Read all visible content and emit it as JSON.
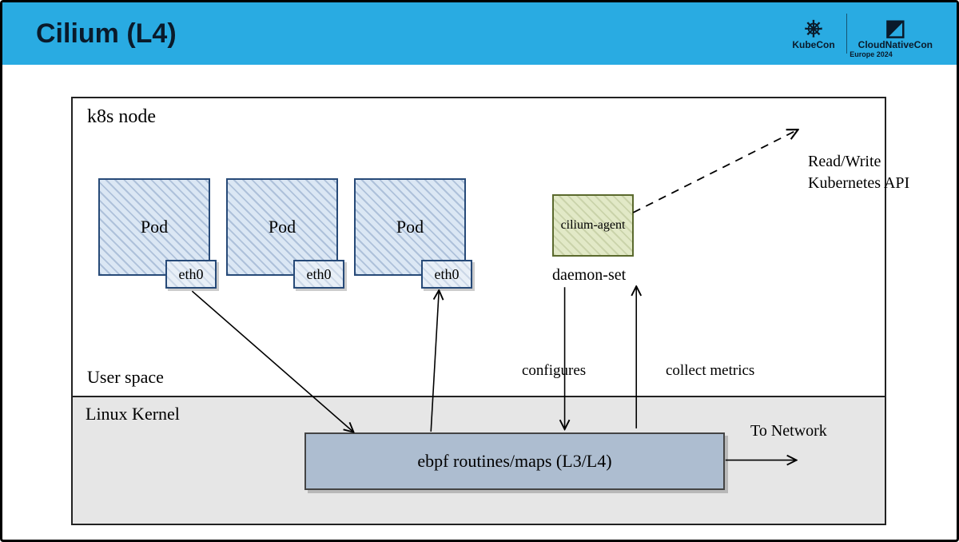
{
  "header": {
    "title": "Cilium (L4)",
    "logos": {
      "left": {
        "icon_label": "KubeCon"
      },
      "right": {
        "icon_label": "CloudNativeCon"
      },
      "subtitle": "Europe 2024"
    }
  },
  "diagram": {
    "node_label": "k8s node",
    "userspace_label": "User space",
    "kernel_label": "Linux Kernel",
    "ebpf_label": "ebpf routines/maps (L3/L4)",
    "pods": [
      {
        "label": "Pod",
        "iface": "eth0"
      },
      {
        "label": "Pod",
        "iface": "eth0"
      },
      {
        "label": "Pod",
        "iface": "eth0"
      }
    ],
    "agent": {
      "label": "cilium-agent",
      "subtitle": "daemon-set"
    },
    "annotations": {
      "configures": "configures",
      "collect": "collect metrics",
      "rw_api": "Read/Write\nKubernetes API",
      "to_network": "To Network"
    }
  }
}
